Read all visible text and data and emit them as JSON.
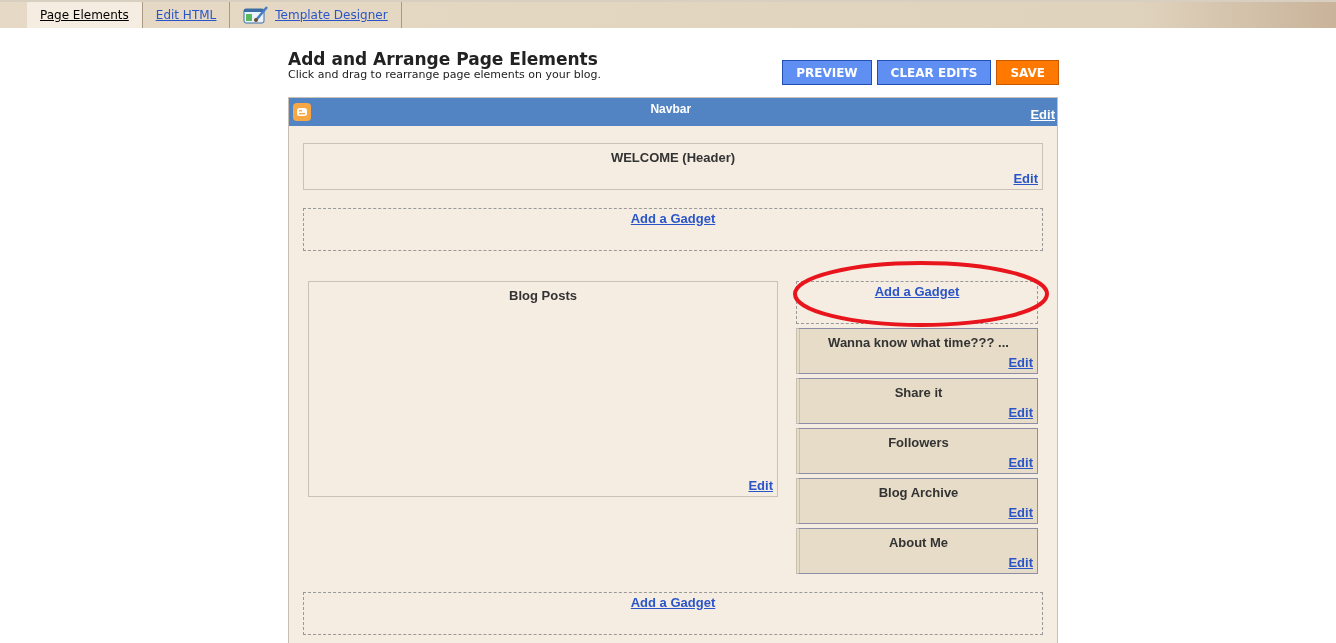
{
  "tabs": [
    {
      "label": "Page Elements",
      "selected": true,
      "icon": false
    },
    {
      "label": "Edit HTML",
      "selected": false,
      "icon": false
    },
    {
      "label": "Template Designer",
      "selected": false,
      "icon": true
    }
  ],
  "heading": {
    "title": "Add and Arrange Page Elements",
    "subtitle": "Click and drag to rearrange page elements on your blog."
  },
  "buttons": [
    {
      "label": "PREVIEW",
      "kind": "blue"
    },
    {
      "label": "CLEAR EDITS",
      "kind": "blue"
    },
    {
      "label": "SAVE",
      "kind": "orange"
    }
  ],
  "navbar": {
    "title": "Navbar",
    "edit": "Edit"
  },
  "header": {
    "title": "WELCOME (Header)",
    "edit": "Edit"
  },
  "add_gadget_top": "Add a Gadget",
  "main": {
    "title": "Blog Posts",
    "edit": "Edit"
  },
  "sidebar": {
    "add_gadget": "Add a Gadget",
    "highlighted": true,
    "gadgets": [
      {
        "title": "Wanna know what time??? ...",
        "edit": "Edit"
      },
      {
        "title": "Share it",
        "edit": "Edit"
      },
      {
        "title": "Followers",
        "edit": "Edit"
      },
      {
        "title": "Blog Archive",
        "edit": "Edit"
      },
      {
        "title": "About Me",
        "edit": "Edit"
      }
    ]
  },
  "add_gadget_bottom": "Add a Gadget"
}
